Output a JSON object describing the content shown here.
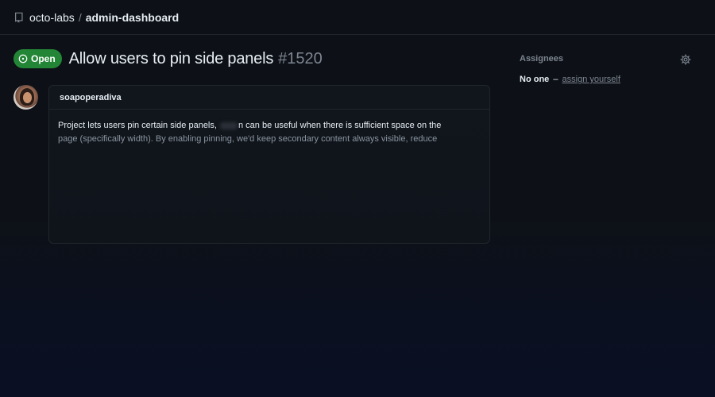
{
  "breadcrumb": {
    "owner": "octo-labs",
    "separator": "/",
    "repo": "admin-dashboard"
  },
  "issue": {
    "state": "Open",
    "title": "Allow users to pin side panels",
    "number": "#1520"
  },
  "comment": {
    "author": "soapoperadiva",
    "line1_start": "Project lets users pin certain side panels,",
    "line1_end": "n can be useful when there is sufficient space on the",
    "line2": "page (specifically width). By enabling pinning, we'd keep secondary content always visible, reduce"
  },
  "sidebar": {
    "assignees_label": "Assignees",
    "no_one": "No one",
    "dash": "–",
    "assign_link": "assign yourself"
  },
  "colors": {
    "background": "#0d1117",
    "open_badge": "#238636",
    "muted_text": "#7d8590"
  },
  "icons": {
    "repo": "repo-icon",
    "open_state": "issue-opened-icon",
    "settings": "gear-icon"
  }
}
